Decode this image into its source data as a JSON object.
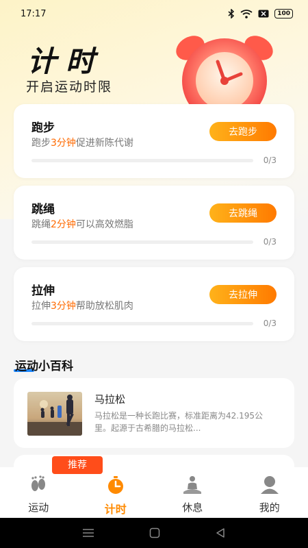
{
  "status_bar": {
    "time": "17:17",
    "battery": "100"
  },
  "hero": {
    "title": "计时",
    "subtitle": "开启运动时限"
  },
  "exercises": [
    {
      "title": "跑步",
      "desc_prefix": "跑步",
      "desc_highlight": "3分钟",
      "desc_suffix": "促进新陈代谢",
      "button": "去跑步",
      "progress": "0/3",
      "progress_fraction": 0
    },
    {
      "title": "跳绳",
      "desc_prefix": "跳绳",
      "desc_highlight": "2分钟",
      "desc_suffix": "可以高效燃脂",
      "button": "去跳绳",
      "progress": "0/3",
      "progress_fraction": 0
    },
    {
      "title": "拉伸",
      "desc_prefix": "拉伸",
      "desc_highlight": "3分钟",
      "desc_suffix": "帮助放松肌肉",
      "button": "去拉伸",
      "progress": "0/3",
      "progress_fraction": 0
    }
  ],
  "encyclopedia": {
    "section_title": "运动小百科",
    "article": {
      "title": "马拉松",
      "excerpt": "马拉松是一种长跑比赛，标准距离为42.195公里。起源于古希腊的马拉松..."
    },
    "badge": "推荐"
  },
  "tabs": [
    {
      "label": "运动",
      "icon": "footprints-icon",
      "active": false
    },
    {
      "label": "计时",
      "icon": "timer-icon",
      "active": true
    },
    {
      "label": "休息",
      "icon": "meditation-icon",
      "active": false
    },
    {
      "label": "我的",
      "icon": "profile-icon",
      "active": false
    }
  ],
  "colors": {
    "accent": "#ff8a00",
    "highlight": "#ff6a00",
    "badge": "#ff4d1a",
    "underline": "#1e88ff"
  }
}
